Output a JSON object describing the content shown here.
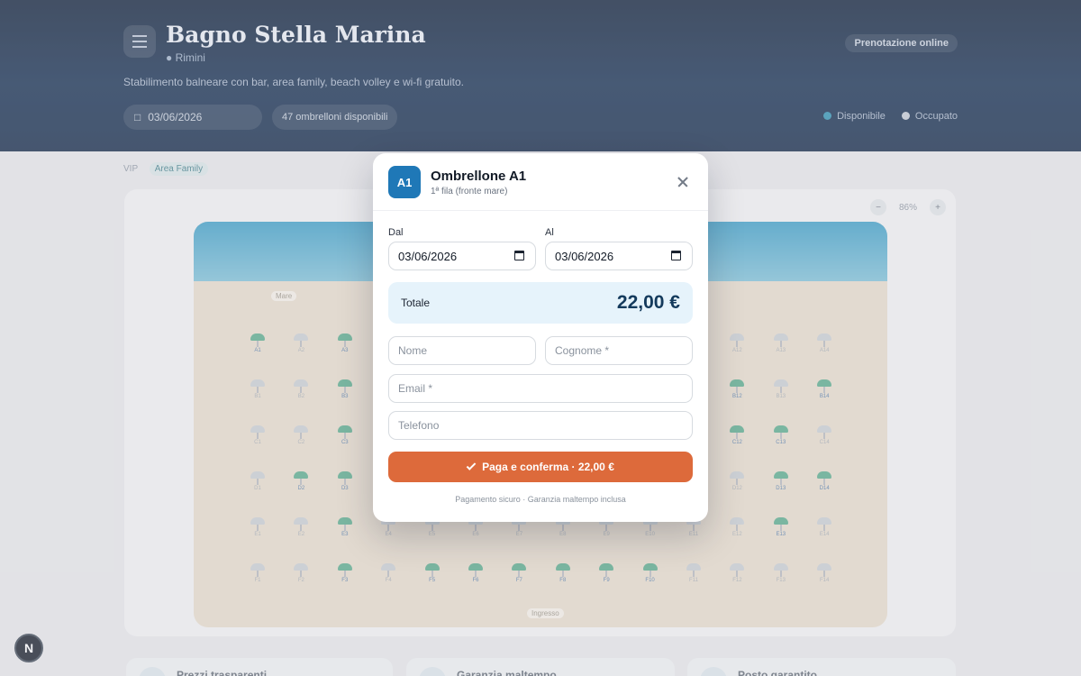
{
  "header": {
    "title": "Bagno Stella Marina",
    "location": "Rimini",
    "description": "Stabilimento balneare con bar, area family, beach volley e wi-fi gratuito.",
    "badge": "Prenotazione online",
    "date": "03/06/2026",
    "available_count": "47 ombrelloni disponibili",
    "legend": {
      "free": "Disponibile",
      "busy": "Occupato"
    }
  },
  "breadcrumb": {
    "first": "VIP",
    "active": "Area Family"
  },
  "map": {
    "zoom_label": "86%",
    "labels": {
      "top": "Mare",
      "bottom": "Ingresso"
    },
    "rows": [
      {
        "nums": [
          "A1",
          "A2",
          "A3",
          "A4",
          "A5",
          "A6",
          "A7",
          "A8",
          "A9",
          "A10",
          "A11",
          "A12",
          "A13",
          "A14"
        ],
        "free": [
          0,
          2
        ]
      },
      {
        "nums": [
          "B1",
          "B2",
          "B3",
          "B4",
          "B5",
          "B6",
          "B7",
          "B8",
          "B9",
          "B10",
          "B11",
          "B12",
          "B13",
          "B14"
        ],
        "free": [
          2,
          11,
          13
        ]
      },
      {
        "nums": [
          "C1",
          "C2",
          "C3",
          "C4",
          "C5",
          "C6",
          "C7",
          "C8",
          "C9",
          "C10",
          "C11",
          "C12",
          "C13",
          "C14"
        ],
        "free": [
          2,
          11,
          12
        ]
      },
      {
        "nums": [
          "D1",
          "D2",
          "D3",
          "D4",
          "D5",
          "D6",
          "D7",
          "D8",
          "D9",
          "D10",
          "D11",
          "D12",
          "D13",
          "D14"
        ],
        "free": [
          1,
          2,
          12,
          13
        ]
      },
      {
        "nums": [
          "E1",
          "E2",
          "E3",
          "E4",
          "E5",
          "E6",
          "E7",
          "E8",
          "E9",
          "E10",
          "E11",
          "E12",
          "E13",
          "E14"
        ],
        "free": [
          2,
          12
        ]
      },
      {
        "nums": [
          "F1",
          "F2",
          "F3",
          "F4",
          "F5",
          "F6",
          "F7",
          "F8",
          "F9",
          "F10",
          "F11",
          "F12",
          "F13",
          "F14"
        ],
        "free": [
          2,
          4,
          5,
          6,
          7,
          8,
          9
        ]
      }
    ]
  },
  "features": [
    "Prezzi trasparenti",
    "Garanzia maltempo",
    "Posto garantito"
  ],
  "modal": {
    "badge": "A1",
    "title": "Ombrellone A1",
    "subtitle": "1ª fila (fronte mare)",
    "from_label": "Dal",
    "to_label": "Al",
    "from_value": "03/06/2026",
    "to_value": "03/06/2026",
    "total_label": "Totale",
    "total_value": "22,00 €",
    "placeholders": {
      "first_name": "Nome",
      "last_name": "Cognome *",
      "email": "Email *",
      "phone": "Telefono"
    },
    "pay_label": "Paga e conferma · 22,00 €",
    "footer": "Pagamento sicuro · Garanzia maltempo inclusa"
  },
  "colors": {
    "accent": "#1f78b7",
    "pay": "#dd6a3b",
    "free": "#57a98a",
    "hero": "#0a1c36"
  },
  "next_badge": "N"
}
